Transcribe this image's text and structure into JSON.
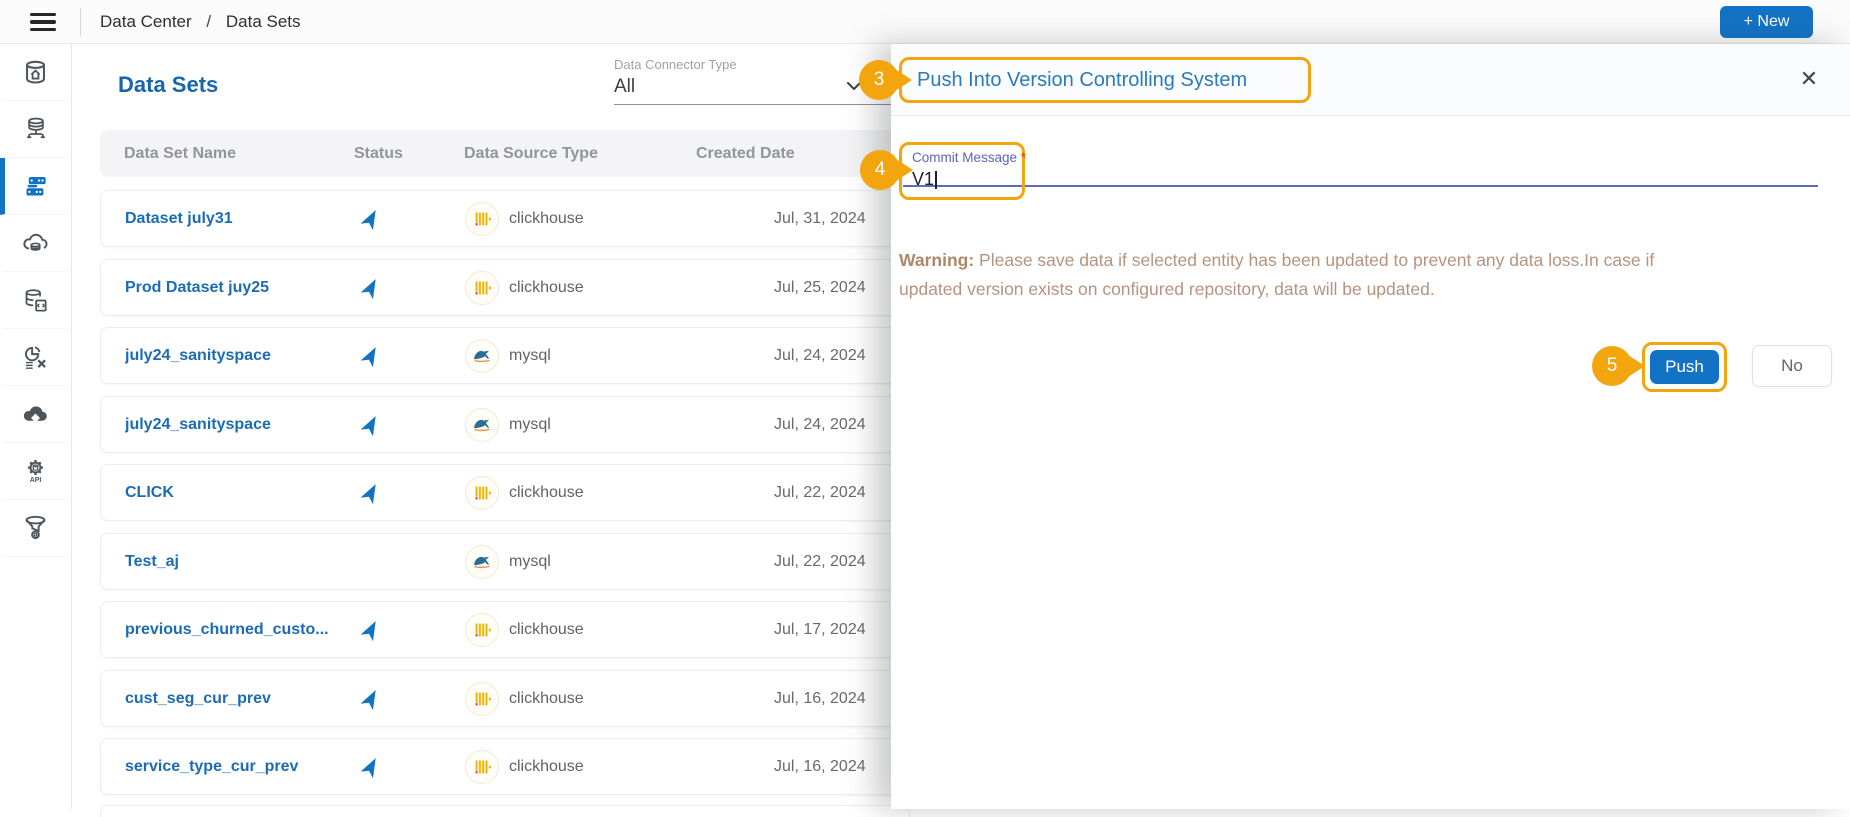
{
  "topbar": {
    "breadcrumb": {
      "part1": "Data Center",
      "separator": "/",
      "part2": "Data Sets"
    },
    "new_button": "+ New"
  },
  "sidebar": {
    "items": [
      {
        "name": "data-center-home",
        "active": false
      },
      {
        "name": "database-connections",
        "active": false
      },
      {
        "name": "data-sets",
        "active": true
      },
      {
        "name": "cloud-database",
        "active": false
      },
      {
        "name": "dataset-code",
        "active": false
      },
      {
        "name": "data-cleanup",
        "active": false
      },
      {
        "name": "cloud-lakehouse",
        "active": false
      },
      {
        "name": "api-gateway",
        "active": false
      },
      {
        "name": "data-pipeline",
        "active": false
      }
    ]
  },
  "main": {
    "title": "Data Sets",
    "filter": {
      "label": "Data Connector Type",
      "value": "All"
    },
    "table": {
      "headers": [
        "Data Set Name",
        "Status",
        "Data Source Type",
        "Created Date"
      ],
      "rows": [
        {
          "name": "Dataset july31",
          "status": "published",
          "source": "clickhouse",
          "source_label": "clickhouse",
          "created": "Jul, 31, 2024"
        },
        {
          "name": "Prod Dataset juy25",
          "status": "published",
          "source": "clickhouse",
          "source_label": "clickhouse",
          "created": "Jul, 25, 2024"
        },
        {
          "name": "july24_sanityspace",
          "status": "published",
          "source": "mysql",
          "source_label": "mysql",
          "created": "Jul, 24, 2024"
        },
        {
          "name": "july24_sanityspace",
          "status": "published",
          "source": "mysql",
          "source_label": "mysql",
          "created": "Jul, 24, 2024"
        },
        {
          "name": "CLICK",
          "status": "published",
          "source": "clickhouse",
          "source_label": "clickhouse",
          "created": "Jul, 22, 2024"
        },
        {
          "name": "Test_aj",
          "status": "",
          "source": "mysql",
          "source_label": "mysql",
          "created": "Jul, 22, 2024"
        },
        {
          "name": "previous_churned_custo...",
          "status": "published",
          "source": "clickhouse",
          "source_label": "clickhouse",
          "created": "Jul, 17, 2024"
        },
        {
          "name": "cust_seg_cur_prev",
          "status": "published",
          "source": "clickhouse",
          "source_label": "clickhouse",
          "created": "Jul, 16, 2024"
        },
        {
          "name": "service_type_cur_prev",
          "status": "published",
          "source": "clickhouse",
          "source_label": "clickhouse",
          "created": "Jul, 16, 2024"
        }
      ]
    }
  },
  "panel": {
    "title": "Push Into Version Controlling System",
    "close": "✕",
    "commit": {
      "label": "Commit Message",
      "required": "*",
      "value": "V1"
    },
    "warning": {
      "bold": "Warning:",
      "line1": "Please save data if selected entity has been updated to prevent any data loss.In case if",
      "line2": "updated version exists on configured repository, data will be updated."
    },
    "push_button": "Push",
    "no_button": "No"
  },
  "callouts": {
    "step3": "3",
    "step4": "4",
    "step5": "5"
  },
  "colors": {
    "accent_blue": "#1273c4",
    "link_blue": "#1b6cb5",
    "title_blue": "#2b7ab9",
    "highlight_orange": "#f3a50d",
    "warning_text": "#b6937e",
    "label_indigo": "#5c6bc0",
    "clickhouse_yellow": "#f4b400",
    "mysql_teal": "#2c6e91"
  }
}
